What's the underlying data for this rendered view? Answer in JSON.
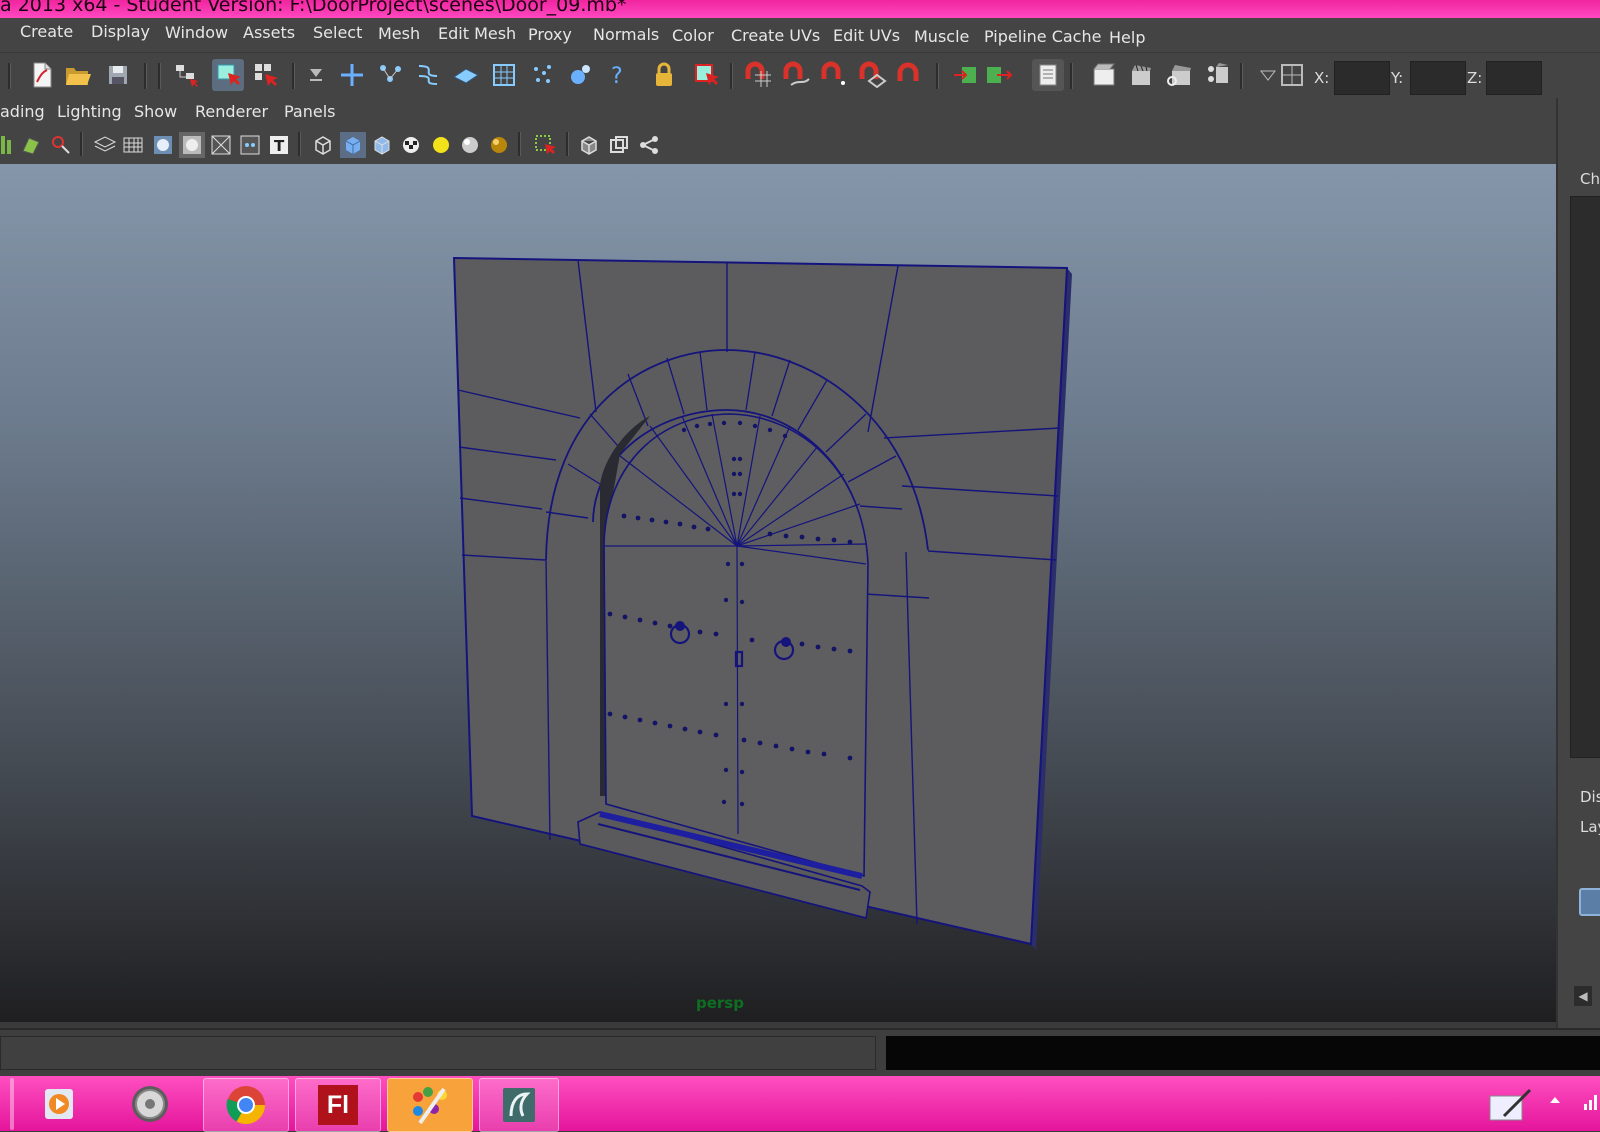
{
  "window": {
    "title": "a 2013 x64 - Student Version: F:\\DoorProject\\scenes\\Door_09.mb*"
  },
  "menubar": {
    "items": [
      "Create",
      "Display",
      "Window",
      "Assets",
      "Select",
      "Mesh",
      "Edit Mesh",
      "Proxy",
      "Normals",
      "Color",
      "Create UVs",
      "Edit UVs",
      "Muscle",
      "Pipeline Cache",
      "Help"
    ]
  },
  "status_line": {
    "x_label": "X:",
    "y_label": "Y:",
    "z_label": "Z:",
    "x_value": "",
    "y_value": "",
    "z_value": ""
  },
  "panel": {
    "menus": [
      "ading",
      "Lighting",
      "Show",
      "Renderer",
      "Panels"
    ],
    "camera_label": "persp"
  },
  "right_panel": {
    "channel_label": "Ch",
    "display_label": "Dis",
    "layers_label": "Lay"
  },
  "taskbar": {
    "apps": [
      "media-player-icon",
      "disc-icon",
      "chrome-icon",
      "flash-icon",
      "paint-icon",
      "maya-icon"
    ],
    "flash_text": "Fl"
  },
  "colors": {
    "title_bar": "#f0259f",
    "taskbar": "#ff40bb",
    "ui_gray": "#444444",
    "wireframe": "#14147c",
    "mesh_gray": "#5d5d5f",
    "camera_label": "#0e6e21"
  }
}
